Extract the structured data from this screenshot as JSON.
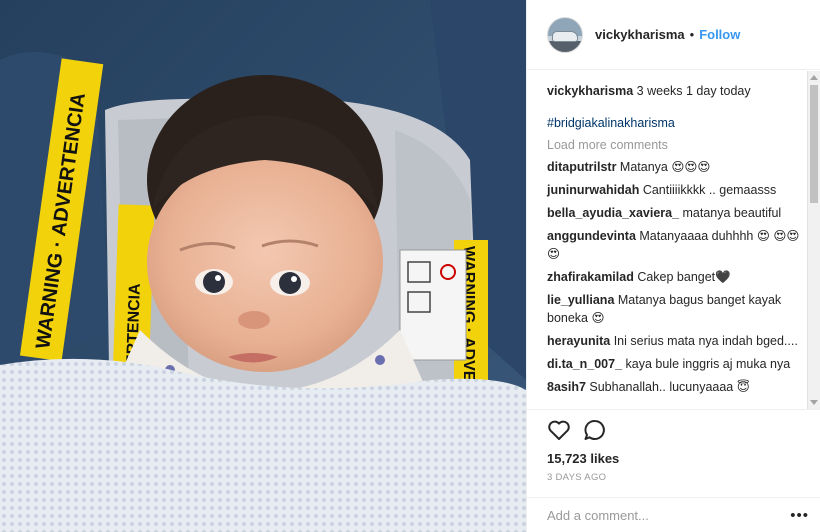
{
  "post": {
    "username": "vickykharisma",
    "follow_label": "Follow",
    "separator": "•",
    "photo_label_warning_left": "WARNING · ADVERTENCIA",
    "photo_label_warning_right": "WARNING · ADVE"
  },
  "caption": {
    "username": "vickykharisma",
    "text": " 3 weeks 1 day today",
    "hashtag": "#bridgiakalinakharisma"
  },
  "load_more": "Load more comments",
  "comments": [
    {
      "user": "ditaputrilstr",
      "text": " Matanya 😍😍😍"
    },
    {
      "user": "juninurwahidah",
      "text": " Cantiiiikkkk .. gemaasss"
    },
    {
      "user": "bella_ayudia_xaviera_",
      "text": " matanya beautiful"
    },
    {
      "user": "anggundevinta",
      "text": " Matanyaaaa duhhhh 😍 😍😍😍"
    },
    {
      "user": "zhafirakamilad",
      "text": " Cakep banget🖤"
    },
    {
      "user": "lie_yulliana",
      "text": " Matanya bagus banget kayak boneka 😍"
    },
    {
      "user": "herayunita",
      "text": " Ini serius mata nya indah bged...."
    },
    {
      "user": "di.ta_n_007_",
      "text": " kaya bule inggris aj muka nya"
    },
    {
      "user": "8asih7",
      "text": " Subhanallah.. lucunyaaaa 😇"
    }
  ],
  "actions": {
    "likes": "15,723 likes",
    "time": "3 DAYS AGO",
    "add_comment_placeholder": "Add a comment...",
    "more_label": "•••",
    "like_icon": "heart-icon",
    "comment_icon": "speech-bubble-icon"
  },
  "colors": {
    "link": "#3897f0",
    "hashtag": "#003569",
    "muted": "#999999",
    "text": "#262626"
  }
}
